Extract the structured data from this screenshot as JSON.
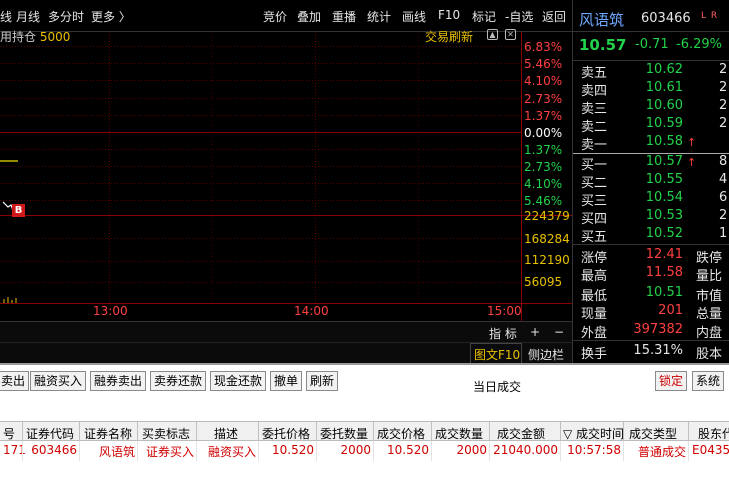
{
  "toolbar": {
    "left_items": [
      "线",
      "月线",
      "多分时",
      "更多 〉"
    ],
    "right_items": [
      "竞价",
      "叠加",
      "重播",
      "统计",
      "画线",
      "F10",
      "标记",
      "-自选",
      "返回"
    ]
  },
  "chart": {
    "sub_header_label": "用持仓",
    "sub_header_value": "5000",
    "refresh_label": "交易刷新",
    "pct_labels_up": [
      "6.83%",
      "5.46%",
      "4.10%",
      "2.73%",
      "1.37%"
    ],
    "pct_label_zero": "0.00%",
    "pct_labels_down": [
      "1.37%",
      "2.73%",
      "4.10%",
      "5.46%"
    ],
    "volume_labels": [
      "224379",
      "168284",
      "112190",
      "56095"
    ],
    "time_labels": [
      "13:00",
      "14:00",
      "15:00"
    ],
    "trade_marker": "B",
    "colors": {
      "up": "#ff4040",
      "down": "#22d24a",
      "volume": "#e8c000",
      "grid": "#8b0000"
    }
  },
  "controls": {
    "index_label": "指 标",
    "plus_label": "+",
    "minus_label": "−",
    "f10_label": "图文F10",
    "sidebar_label": "侧边栏"
  },
  "quote": {
    "name": "风语筑",
    "code": "603466",
    "flags": "L R",
    "price": "10.57",
    "change": "-0.71",
    "change_pct": "-6.29%",
    "asks": [
      {
        "label": "卖五",
        "price": "10.62",
        "extra": "2"
      },
      {
        "label": "卖四",
        "price": "10.61",
        "extra": "2"
      },
      {
        "label": "卖三",
        "price": "10.60",
        "extra": "2"
      },
      {
        "label": "卖二",
        "price": "10.59",
        "extra": "2"
      },
      {
        "label": "卖一",
        "price": "10.58",
        "extra": "",
        "arrow": "↑"
      }
    ],
    "bids": [
      {
        "label": "买一",
        "price": "10.57",
        "extra": "8",
        "arrow": "↑"
      },
      {
        "label": "买二",
        "price": "10.55",
        "extra": "4"
      },
      {
        "label": "买三",
        "price": "10.54",
        "extra": "6"
      },
      {
        "label": "买四",
        "price": "10.53",
        "extra": "2"
      },
      {
        "label": "买五",
        "price": "10.52",
        "extra": "1"
      }
    ],
    "stats": [
      {
        "label": "涨停",
        "value": "12.41",
        "color": "#ff4040",
        "label2": "跌停"
      },
      {
        "label": "最高",
        "value": "11.58",
        "color": "#ff4040",
        "label2": "量比"
      },
      {
        "label": "最低",
        "value": "10.51",
        "color": "#22d24a",
        "label2": "市值"
      },
      {
        "label": "现量",
        "value": "201",
        "color": "#ff4040",
        "label2": "总量"
      },
      {
        "label": "外盘",
        "value": "397382",
        "color": "#ff4040",
        "label2": "内盘"
      },
      {
        "label": "换手",
        "value": "15.31%",
        "color": "#e6e6e6",
        "label2": "股本"
      }
    ]
  },
  "orders": {
    "buttons": [
      "卖出",
      "融资买入",
      "融券卖出",
      "卖券还款",
      "现金还款",
      "撤单",
      "刷新"
    ],
    "title": "当日成交",
    "lock_label": "锁定",
    "system_label": "系统",
    "columns": [
      "号",
      "证券代码",
      "证券名称",
      "买卖标志",
      "描述",
      "委托价格",
      "委托数量",
      "成交价格",
      "成交数量",
      "成交金额",
      "▽ 成交时间",
      "成交类型",
      "股东代"
    ],
    "rows": [
      [
        "171",
        "603466",
        "风语筑",
        "证券买入",
        "融资买入",
        "10.520",
        "2000",
        "10.520",
        "2000",
        "21040.000",
        "10:57:58",
        "普通成交",
        "E0435"
      ]
    ]
  }
}
